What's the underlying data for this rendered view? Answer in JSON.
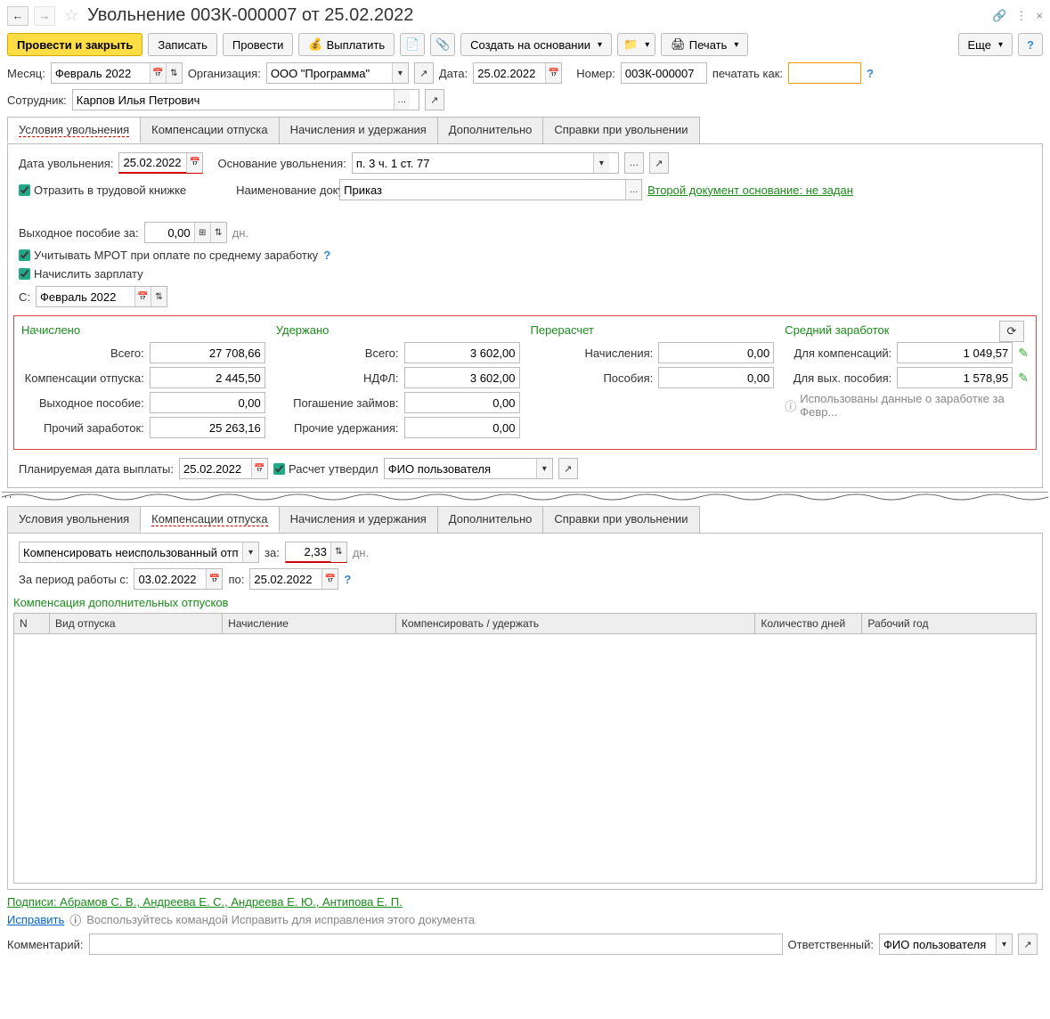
{
  "title": "Увольнение 00ЗК-000007 от 25.02.2022",
  "toolbar": {
    "post_close": "Провести и закрыть",
    "save": "Записать",
    "post": "Провести",
    "pay": "Выплатить",
    "create_based": "Создать на основании",
    "print": "Печать",
    "more": "Еще"
  },
  "header": {
    "month_lbl": "Месяц:",
    "month": "Февраль 2022",
    "org_lbl": "Организация:",
    "org": "ООО \"Программа\"",
    "date_lbl": "Дата:",
    "date": "25.02.2022",
    "number_lbl": "Номер:",
    "number": "00ЗК-000007",
    "print_as_lbl": "печатать как:",
    "print_as": "",
    "employee_lbl": "Сотрудник:",
    "employee": "Карпов Илья Петрович"
  },
  "tabs": {
    "t1": "Условия увольнения",
    "t2": "Компенсации отпуска",
    "t3": "Начисления и удержания",
    "t4": "Дополнительно",
    "t5": "Справки при увольнении"
  },
  "tab1": {
    "dismiss_date_lbl": "Дата увольнения:",
    "dismiss_date": "25.02.2022",
    "basis_lbl": "Основание увольнения:",
    "basis": "п. 3 ч. 1 ст. 77",
    "reflect_chk": "Отразить в трудовой книжке",
    "doc_name_lbl": "Наименование документа:",
    "doc_name": "Приказ",
    "second_doc_link": "Второй документ основание: не задан",
    "severance_lbl": "Выходное пособие за:",
    "severance_val": "0,00",
    "severance_unit": "дн.",
    "mrot_chk": "Учитывать МРОТ при оплате по среднему заработку",
    "accrue_chk": "Начислить зарплату",
    "from_lbl": "С:",
    "from_val": "Февраль 2022"
  },
  "summary": {
    "accrued_head": "Начислено",
    "withheld_head": "Удержано",
    "recalc_head": "Перерасчет",
    "avg_head": "Средний заработок",
    "total_lbl": "Всего:",
    "accrued_total": "27 708,66",
    "comp_lbl": "Компенсации отпуска:",
    "comp_val": "2 445,50",
    "sev_lbl": "Выходное пособие:",
    "sev_val": "0,00",
    "other_lbl": "Прочий заработок:",
    "other_val": "25 263,16",
    "withheld_total": "3 602,00",
    "ndfl_lbl": "НДФЛ:",
    "ndfl_val": "3 602,00",
    "loan_lbl": "Погашение займов:",
    "loan_val": "0,00",
    "other_with_lbl": "Прочие удержания:",
    "other_with_val": "0,00",
    "recalc_acc_lbl": "Начисления:",
    "recalc_acc_val": "0,00",
    "recalc_ben_lbl": "Пособия:",
    "recalc_ben_val": "0,00",
    "avg_comp_lbl": "Для компенсаций:",
    "avg_comp_val": "1 049,57",
    "avg_sev_lbl": "Для вых. пособия:",
    "avg_sev_val": "1 578,95",
    "info_note": "Использованы данные о заработке за Февр..."
  },
  "planned": {
    "pay_date_lbl": "Планируемая дата выплаты:",
    "pay_date": "25.02.2022",
    "approved_chk": "Расчет утвердил",
    "approved_by": "ФИО пользователя"
  },
  "tab2": {
    "comp_select": "Компенсировать неиспользованный отпуск",
    "for_lbl": "за:",
    "for_val": "2,33",
    "for_unit": "дн.",
    "period_lbl": "За период работы с:",
    "period_from": "03.02.2022",
    "period_to_lbl": "по:",
    "period_to": "25.02.2022",
    "subtitle": "Компенсация дополнительных отпусков",
    "cols": {
      "n": "N",
      "type": "Вид отпуска",
      "accrual": "Начисление",
      "comp": "Компенсировать / удержать",
      "days": "Количество дней",
      "year": "Рабочий год"
    }
  },
  "footer": {
    "signatures": "Подписи: Абрамов С. В., Андреева Е. С., Андреева Е. Ю., Антипова Е. П.",
    "fix_link": "Исправить",
    "fix_note": "Воспользуйтесь командой Исправить для исправления этого документа",
    "comment_lbl": "Комментарий:",
    "responsible_lbl": "Ответственный:",
    "responsible": "ФИО пользователя"
  }
}
